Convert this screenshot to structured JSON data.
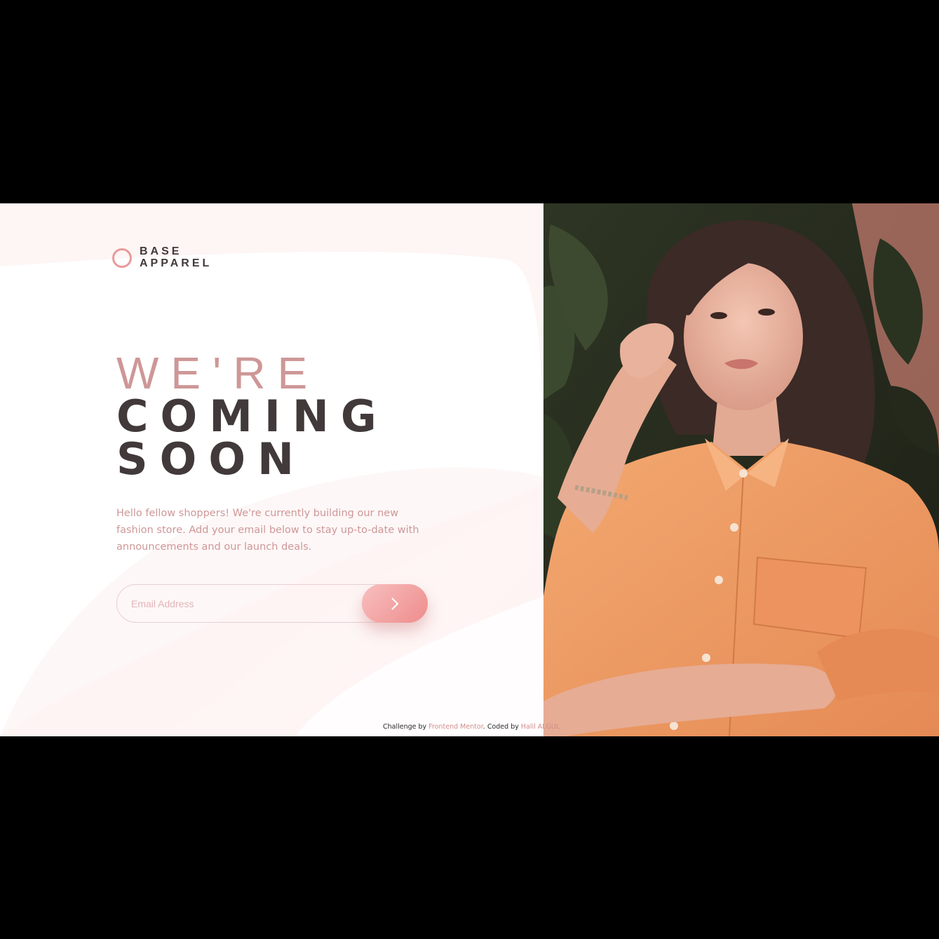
{
  "brand": {
    "line1": "BASE",
    "line2": "APPAREL"
  },
  "hero": {
    "headline_light": "WE'RE",
    "headline_bold_1": "COMING",
    "headline_bold_2": "SOON",
    "intro": "Hello fellow shoppers! We're currently building our new fashion store. Add your email below to stay up-to-date with announcements and our launch deals."
  },
  "form": {
    "email_placeholder": "Email Address",
    "submit_icon": "arrow-right-icon"
  },
  "footer": {
    "prefix": "Challenge by",
    "link1": "Frontend Mentor",
    "middle": ". Coded by",
    "link2": "Halil ALGUL"
  },
  "colors": {
    "accent": "#ce9797",
    "dark_text": "#423a3a",
    "button_start": "#f8bfbf",
    "button_end": "#ee8c8c",
    "shirt": "#f09b66"
  },
  "hero_image": {
    "subject": "woman-in-orange-shirt-photo"
  }
}
